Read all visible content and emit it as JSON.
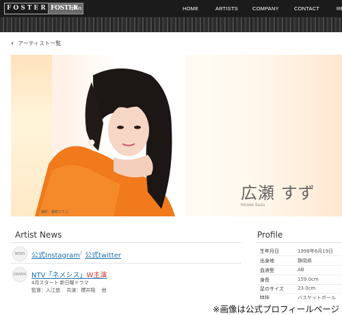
{
  "header": {
    "logo_main": "FOSTER",
    "logo_sub": "FOSTER",
    "logo_plus": "plus",
    "nav": [
      "HOME",
      "ARTISTS",
      "COMPANY",
      "CONTACT",
      "RE"
    ]
  },
  "back_link": "アーティスト一覧",
  "hero": {
    "photo_credit": "撮影：秦田フミコ",
    "name_jp": "広瀬 すず",
    "name_en": "Hirose Suzu"
  },
  "news": {
    "title": "Artist News",
    "items": [
      {
        "badge": "NEWS",
        "link1": "公式Instagram",
        "separator": "/",
        "link2": "公式twitter"
      },
      {
        "badge": "DRAMA",
        "link": "NTV「ネメシス」",
        "highlight": "W主演",
        "line1": "4月スタート 新日曜ドラマ",
        "line2": "監督：入江悠 　共演：櫻井翔 　他"
      }
    ]
  },
  "profile": {
    "title": "Profile",
    "rows": [
      {
        "label": "生年月日",
        "value": "1998年6月19日"
      },
      {
        "label": "出身地",
        "value": "静岡県"
      },
      {
        "label": "血液型",
        "value": "AB"
      },
      {
        "label": "身長",
        "value": "159.0cm"
      },
      {
        "label": "足のサイズ",
        "value": "23.0cm"
      },
      {
        "label": "特技",
        "value": "バスケットボール"
      }
    ]
  },
  "caption": "※画像は公式プロフィールページ"
}
